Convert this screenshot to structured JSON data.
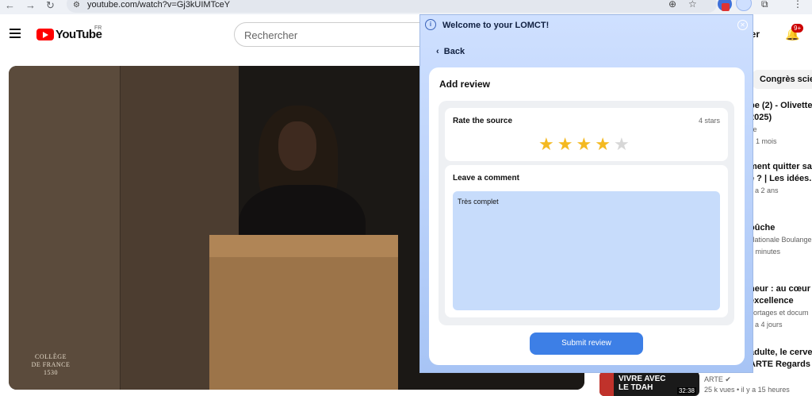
{
  "browser": {
    "url": "youtube.com/watch?v=Gj3kUIMTceY"
  },
  "header": {
    "logo_text": "YouTube",
    "logo_region": "FR",
    "search_placeholder": "Rechercher",
    "create_fragment": "éer",
    "notification_count": "9+"
  },
  "video": {
    "watermark_line1": "COLLÈGE",
    "watermark_line2": "DE FRANCE",
    "watermark_line3": "1530"
  },
  "sidebar": {
    "chip": "Congrès scie",
    "recs": [
      {
        "line1": "pe (2) - Olivette",
        "line2": "2025)",
        "meta1": "ce",
        "meta2": "1 mois"
      },
      {
        "line1": "ment quitter sa",
        "line2": "e ? | Les idées...",
        "meta1": "y a 2 ans",
        "meta2": ""
      },
      {
        "line1": "oûche",
        "line2": "",
        "meta1": "Nationale Boulange",
        "meta2": "2 minutes"
      },
      {
        "line1": "heur : au cœur d",
        "line2": "excellence",
        "meta1": "portages et docum",
        "meta2": "y a 4 jours"
      },
      {
        "line1": "adulte, le cervea",
        "line2": "ARTE Regards",
        "meta1": "",
        "meta2": ""
      }
    ],
    "bottom_thumb": {
      "text1": "VIVRE AVEC",
      "text2": "LE TDAH",
      "duration": "32:38"
    },
    "bottom_channel": "ARTE",
    "bottom_meta": "25 k vues • il y a 15 heures"
  },
  "panel": {
    "title": "Welcome to your LOMCT!",
    "back_label": "Back",
    "card_title": "Add review",
    "rate_label": "Rate the source",
    "rating": 4,
    "rating_max": 5,
    "rating_text": "4 stars",
    "comment_label": "Leave a comment",
    "comment_value": "Très complet",
    "submit_label": "Submit review"
  }
}
